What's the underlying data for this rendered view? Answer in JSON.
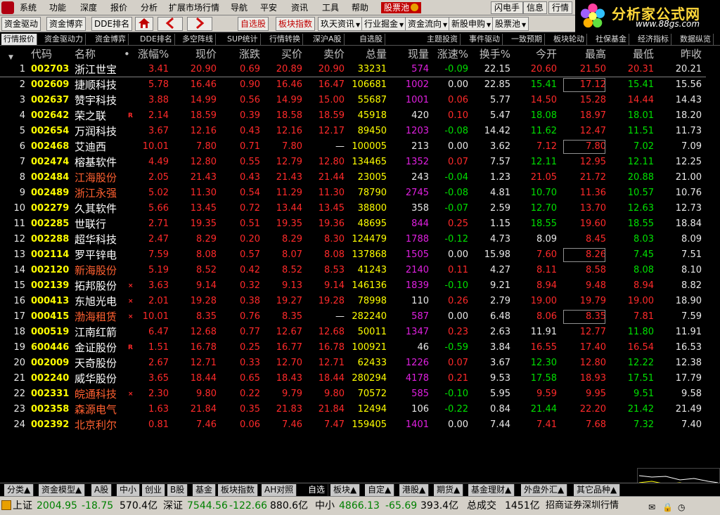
{
  "menu": {
    "items": [
      "系统",
      "功能",
      "深度",
      "报价",
      "分析",
      "扩展市场行情",
      "导航",
      "平安",
      "资讯",
      "工具",
      "帮助"
    ],
    "active": "股票池",
    "right_buttons": [
      "闪电手",
      "信息",
      "行情"
    ]
  },
  "brand": {
    "name": "分析家公式网",
    "url": "www.88gs.com"
  },
  "toolbar": {
    "left": [
      "资金驱动",
      "资金博弈",
      "DDE排名"
    ],
    "right": [
      "自选股",
      "板块指数",
      "玖天资讯",
      "行业掘金",
      "资金流向",
      "新股申购",
      "股票池"
    ]
  },
  "subtabs": [
    "行情报价",
    "资金驱动力",
    "资金博弈",
    "DDE排名",
    "多空阵线",
    "SUP统计",
    "行情转换",
    "深沪A股",
    "自选股",
    "主题投资",
    "事件驱动",
    "一致预期",
    "板块轮动",
    "社保基金",
    "经济指标",
    "数据纵览"
  ],
  "columns": [
    "代码",
    "名称",
    "•",
    "涨幅%",
    "现价",
    "涨跌",
    "买价",
    "卖价",
    "总量",
    "现量",
    "涨速%",
    "换手%",
    "今开",
    "最高",
    "最低",
    "昨收"
  ],
  "rows": [
    {
      "i": "1",
      "code": "002703",
      "name": "浙江世宝",
      "mk": "",
      "chg": "3.41",
      "price": "20.90",
      "d": "0.69",
      "bid": "20.89",
      "ask": "20.90",
      "vol": "33231",
      "cur": "574",
      "spd": "-0.09",
      "to": "22.15",
      "open": "20.60",
      "high": "21.50",
      "low": "20.31",
      "prev": "20.21"
    },
    {
      "i": "2",
      "code": "002609",
      "name": "捷顺科技",
      "mk": "",
      "chg": "5.78",
      "price": "16.46",
      "d": "0.90",
      "bid": "16.46",
      "ask": "16.47",
      "vol": "106681",
      "cur": "1002",
      "spd": "0.00",
      "to": "22.85",
      "open": "15.41",
      "high": "17.12",
      "low": "15.41",
      "prev": "15.56"
    },
    {
      "i": "3",
      "code": "002637",
      "name": "赞宇科技",
      "mk": "",
      "chg": "3.88",
      "price": "14.99",
      "d": "0.56",
      "bid": "14.99",
      "ask": "15.00",
      "vol": "55687",
      "cur": "1001",
      "spd": "0.06",
      "to": "5.77",
      "open": "14.50",
      "high": "15.28",
      "low": "14.44",
      "prev": "14.43"
    },
    {
      "i": "4",
      "code": "002642",
      "name": "荣之联",
      "mk": "R",
      "chg": "2.14",
      "price": "18.59",
      "d": "0.39",
      "bid": "18.58",
      "ask": "18.59",
      "vol": "45918",
      "cur": "420",
      "spd": "0.10",
      "to": "5.47",
      "open": "18.08",
      "high": "18.97",
      "low": "18.01",
      "prev": "18.20"
    },
    {
      "i": "5",
      "code": "002654",
      "name": "万润科技",
      "mk": "",
      "chg": "3.67",
      "price": "12.16",
      "d": "0.43",
      "bid": "12.16",
      "ask": "12.17",
      "vol": "89450",
      "cur": "1203",
      "spd": "-0.08",
      "to": "14.42",
      "open": "11.62",
      "high": "12.47",
      "low": "11.51",
      "prev": "11.73"
    },
    {
      "i": "6",
      "code": "002468",
      "name": "艾迪西",
      "mk": "",
      "chg": "10.01",
      "price": "7.80",
      "d": "0.71",
      "bid": "7.80",
      "ask": "—",
      "vol": "100005",
      "cur": "213",
      "spd": "0.00",
      "to": "3.62",
      "open": "7.12",
      "high": "7.80",
      "low": "7.02",
      "prev": "7.09"
    },
    {
      "i": "7",
      "code": "002474",
      "name": "榕基软件",
      "mk": "",
      "chg": "4.49",
      "price": "12.80",
      "d": "0.55",
      "bid": "12.79",
      "ask": "12.80",
      "vol": "134465",
      "cur": "1352",
      "spd": "0.07",
      "to": "7.57",
      "open": "12.11",
      "high": "12.95",
      "low": "12.11",
      "prev": "12.25"
    },
    {
      "i": "8",
      "code": "002484",
      "name": "江海股份",
      "mk": "",
      "chg": "2.05",
      "price": "21.43",
      "d": "0.43",
      "bid": "21.43",
      "ask": "21.44",
      "vol": "23005",
      "cur": "243",
      "spd": "-0.04",
      "to": "1.23",
      "open": "21.05",
      "high": "21.72",
      "low": "20.88",
      "prev": "21.00"
    },
    {
      "i": "9",
      "code": "002489",
      "name": "浙江永强",
      "mk": "",
      "chg": "5.02",
      "price": "11.30",
      "d": "0.54",
      "bid": "11.29",
      "ask": "11.30",
      "vol": "78790",
      "cur": "2745",
      "spd": "-0.08",
      "to": "4.81",
      "open": "10.70",
      "high": "11.36",
      "low": "10.57",
      "prev": "10.76"
    },
    {
      "i": "10",
      "code": "002279",
      "name": "久其软件",
      "mk": "",
      "chg": "5.66",
      "price": "13.45",
      "d": "0.72",
      "bid": "13.44",
      "ask": "13.45",
      "vol": "38800",
      "cur": "358",
      "spd": "-0.07",
      "to": "2.59",
      "open": "12.70",
      "high": "13.70",
      "low": "12.63",
      "prev": "12.73"
    },
    {
      "i": "11",
      "code": "002285",
      "name": "世联行",
      "mk": "",
      "chg": "2.71",
      "price": "19.35",
      "d": "0.51",
      "bid": "19.35",
      "ask": "19.36",
      "vol": "48695",
      "cur": "844",
      "spd": "0.25",
      "to": "1.15",
      "open": "18.55",
      "high": "19.60",
      "low": "18.55",
      "prev": "18.84"
    },
    {
      "i": "12",
      "code": "002288",
      "name": "超华科技",
      "mk": "",
      "chg": "2.47",
      "price": "8.29",
      "d": "0.20",
      "bid": "8.29",
      "ask": "8.30",
      "vol": "124479",
      "cur": "1788",
      "spd": "-0.12",
      "to": "4.73",
      "open": "8.09",
      "high": "8.45",
      "low": "8.03",
      "prev": "8.09"
    },
    {
      "i": "13",
      "code": "002114",
      "name": "罗平锌电",
      "mk": "",
      "chg": "7.59",
      "price": "8.08",
      "d": "0.57",
      "bid": "8.07",
      "ask": "8.08",
      "vol": "137868",
      "cur": "1505",
      "spd": "0.00",
      "to": "15.98",
      "open": "7.60",
      "high": "8.26",
      "low": "7.45",
      "prev": "7.51"
    },
    {
      "i": "14",
      "code": "002120",
      "name": "新海股份",
      "mk": "",
      "chg": "5.19",
      "price": "8.52",
      "d": "0.42",
      "bid": "8.52",
      "ask": "8.53",
      "vol": "41243",
      "cur": "2140",
      "spd": "0.11",
      "to": "4.27",
      "open": "8.11",
      "high": "8.58",
      "low": "8.08",
      "prev": "8.10"
    },
    {
      "i": "15",
      "code": "002139",
      "name": "拓邦股份",
      "mk": "×",
      "chg": "3.63",
      "price": "9.14",
      "d": "0.32",
      "bid": "9.13",
      "ask": "9.14",
      "vol": "146136",
      "cur": "1839",
      "spd": "-0.10",
      "to": "9.21",
      "open": "8.94",
      "high": "9.48",
      "low": "8.94",
      "prev": "8.82"
    },
    {
      "i": "16",
      "code": "000413",
      "name": "东旭光电",
      "mk": "×",
      "chg": "2.01",
      "price": "19.28",
      "d": "0.38",
      "bid": "19.27",
      "ask": "19.28",
      "vol": "78998",
      "cur": "110",
      "spd": "0.26",
      "to": "2.79",
      "open": "19.00",
      "high": "19.79",
      "low": "19.00",
      "prev": "18.90"
    },
    {
      "i": "17",
      "code": "000415",
      "name": "渤海租赁",
      "mk": "×",
      "chg": "10.01",
      "price": "8.35",
      "d": "0.76",
      "bid": "8.35",
      "ask": "—",
      "vol": "282240",
      "cur": "587",
      "spd": "0.00",
      "to": "6.48",
      "open": "8.06",
      "high": "8.35",
      "low": "7.81",
      "prev": "7.59"
    },
    {
      "i": "18",
      "code": "000519",
      "name": "江南红箭",
      "mk": "",
      "chg": "6.47",
      "price": "12.68",
      "d": "0.77",
      "bid": "12.67",
      "ask": "12.68",
      "vol": "50011",
      "cur": "1347",
      "spd": "0.23",
      "to": "2.63",
      "open": "11.91",
      "high": "12.77",
      "low": "11.80",
      "prev": "11.91"
    },
    {
      "i": "19",
      "code": "600446",
      "name": "金证股份",
      "mk": "R",
      "chg": "1.51",
      "price": "16.78",
      "d": "0.25",
      "bid": "16.77",
      "ask": "16.78",
      "vol": "100921",
      "cur": "46",
      "spd": "-0.59",
      "to": "3.84",
      "open": "16.55",
      "high": "17.40",
      "low": "16.54",
      "prev": "16.53"
    },
    {
      "i": "20",
      "code": "002009",
      "name": "天奇股份",
      "mk": "",
      "chg": "2.67",
      "price": "12.71",
      "d": "0.33",
      "bid": "12.70",
      "ask": "12.71",
      "vol": "62433",
      "cur": "1226",
      "spd": "0.07",
      "to": "3.67",
      "open": "12.30",
      "high": "12.80",
      "low": "12.22",
      "prev": "12.38"
    },
    {
      "i": "21",
      "code": "002240",
      "name": "威华股份",
      "mk": "",
      "chg": "3.65",
      "price": "18.44",
      "d": "0.65",
      "bid": "18.43",
      "ask": "18.44",
      "vol": "280294",
      "cur": "4178",
      "spd": "0.21",
      "to": "9.53",
      "open": "17.58",
      "high": "18.93",
      "low": "17.51",
      "prev": "17.79"
    },
    {
      "i": "22",
      "code": "002331",
      "name": "皖通科技",
      "mk": "×",
      "chg": "2.30",
      "price": "9.80",
      "d": "0.22",
      "bid": "9.79",
      "ask": "9.80",
      "vol": "70572",
      "cur": "585",
      "spd": "-0.10",
      "to": "5.95",
      "open": "9.59",
      "high": "9.95",
      "low": "9.51",
      "prev": "9.58"
    },
    {
      "i": "23",
      "code": "002358",
      "name": "森源电气",
      "mk": "",
      "chg": "1.63",
      "price": "21.84",
      "d": "0.35",
      "bid": "21.83",
      "ask": "21.84",
      "vol": "12494",
      "cur": "106",
      "spd": "-0.22",
      "to": "0.84",
      "open": "21.44",
      "high": "22.20",
      "low": "21.42",
      "prev": "21.49"
    },
    {
      "i": "24",
      "code": "002392",
      "name": "北京利尔",
      "mk": "",
      "chg": "0.81",
      "price": "7.46",
      "d": "0.06",
      "bid": "7.46",
      "ask": "7.47",
      "vol": "159405",
      "cur": "1401",
      "spd": "0.00",
      "to": "7.44",
      "open": "7.41",
      "high": "7.68",
      "low": "7.32",
      "prev": "7.40"
    }
  ],
  "bottom_tabs": [
    "分类▲",
    "资金模型▲",
    "A股",
    "中小",
    "创业",
    "B股",
    "基金",
    "板块指数",
    "AH对照",
    "自选",
    "板块▲",
    "自定▲",
    "港股▲",
    "期货▲",
    "基金理财▲",
    "外盘外汇▲",
    "其它品种▲"
  ],
  "bottom_selected": "自选",
  "status": {
    "sh_label": "上证",
    "sh_val": "2004.95",
    "sh_chg": "-18.75",
    "sh_amt": "570.4亿",
    "sz_label": "深证",
    "sz_val": "7544.56",
    "sz_chg": "-122.66",
    "sz_amt": "880.6亿",
    "zx_label": "中小",
    "zx_val": "4866.13",
    "zx_chg": "-65.69",
    "zx_amt": "393.4亿",
    "total_label": "总成交",
    "total_amt": "1451亿",
    "broker": "招商证券深圳行情"
  },
  "colors": {
    "up": "#ff2a2a",
    "down": "#00e000",
    "code": "#ffff00",
    "volume_pink": "#e020e0",
    "highlight_name": "#ff6030"
  }
}
